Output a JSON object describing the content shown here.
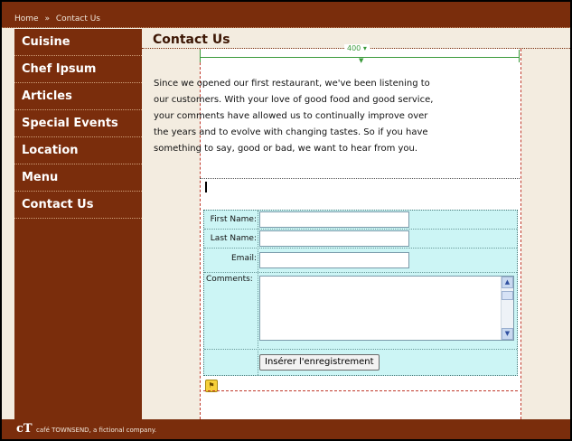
{
  "breadcrumb": {
    "home": "Home",
    "separator": "»",
    "current": "Contact Us"
  },
  "sidebar": {
    "items": [
      {
        "label": "Cuisine"
      },
      {
        "label": "Chef Ipsum"
      },
      {
        "label": "Articles"
      },
      {
        "label": "Special Events"
      },
      {
        "label": "Location"
      },
      {
        "label": "Menu"
      },
      {
        "label": "Contact Us"
      }
    ]
  },
  "page": {
    "title": "Contact Us"
  },
  "ruler": {
    "width_label": "400 ▾"
  },
  "intro": {
    "text": "Since we opened our first restaurant, we've been listening to our customers. With your love of good food and good service, your comments have allowed us to continually improve over the years and to evolve with changing tastes. So if you have something to say, good or bad, we want to hear from you."
  },
  "form": {
    "first_name_label": "First Name:",
    "last_name_label": "Last Name:",
    "email_label": "Email:",
    "comments_label": "Comments:",
    "first_name_value": "",
    "last_name_value": "",
    "email_value": "",
    "comments_value": "",
    "submit_label": "Insérer l'enregistrement"
  },
  "footer": {
    "logo": "cT",
    "text": "café TOWNSEND, a fictional company."
  },
  "colors": {
    "brand": "#7a2d0c",
    "form_bg": "#ccf5f5",
    "page_bg": "#f3ece0"
  }
}
